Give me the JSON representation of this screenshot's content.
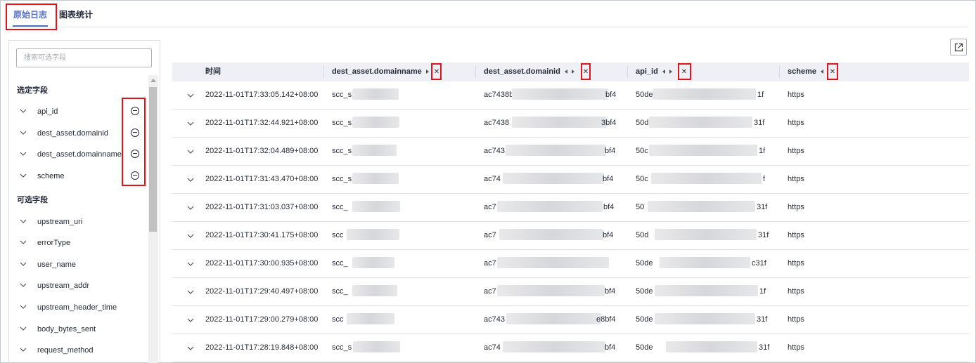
{
  "tabs": [
    {
      "label": "原始日志",
      "active": true
    },
    {
      "label": "图表统计",
      "active": false
    }
  ],
  "sidebar": {
    "search_placeholder": "搜索可选字段",
    "selected_title": "选定字段",
    "selected_fields": [
      "api_id",
      "dest_asset.domainid",
      "dest_asset.domainname",
      "scheme"
    ],
    "available_title": "可选字段",
    "available_fields": [
      "upstream_uri",
      "errorType",
      "user_name",
      "upstream_addr",
      "upstream_header_time",
      "body_bytes_sent",
      "request_method"
    ]
  },
  "table": {
    "headers": {
      "time": "时间",
      "domainname": "dest_asset.domainname",
      "domainid": "dest_asset.domainid",
      "api_id": "api_id",
      "scheme": "scheme"
    },
    "close_glyph": "✕",
    "rows": [
      {
        "time": "2022-11-01T17:33:05.142+08:00",
        "domainname": "scc_s",
        "domainid_pre": "ac7438b",
        "domainid_suf": "bf4",
        "api_pre": "50de",
        "api_suf": "1f",
        "scheme": "https"
      },
      {
        "time": "2022-11-01T17:32:44.921+08:00",
        "domainname": "scc_s",
        "domainid_pre": "ac7438",
        "domainid_suf": "3bf4",
        "api_pre": "50d",
        "api_suf": "31f",
        "scheme": "https"
      },
      {
        "time": "2022-11-01T17:32:04.489+08:00",
        "domainname": "scc_s",
        "domainid_pre": "ac743",
        "domainid_suf": "bf4",
        "api_pre": "50c",
        "api_suf": "1f",
        "scheme": "https"
      },
      {
        "time": "2022-11-01T17:31:43.470+08:00",
        "domainname": "scc_s",
        "domainid_pre": "ac74",
        "domainid_suf": "bf4",
        "api_pre": "50c",
        "api_suf": "f",
        "scheme": "https"
      },
      {
        "time": "2022-11-01T17:31:03.037+08:00",
        "domainname": "scc_",
        "domainid_pre": "ac7",
        "domainid_suf": "bf4",
        "api_pre": "50",
        "api_suf": "31f",
        "scheme": "https"
      },
      {
        "time": "2022-11-01T17:30:41.175+08:00",
        "domainname": "scc",
        "domainid_pre": "ac7",
        "domainid_suf": "bf4",
        "api_pre": "50d",
        "api_suf": "31f",
        "scheme": "https"
      },
      {
        "time": "2022-11-01T17:30:00.935+08:00",
        "domainname": "scc_",
        "domainid_pre": "ac7",
        "domainid_suf": "",
        "api_pre": "50de",
        "api_suf": "c31f",
        "scheme": "https"
      },
      {
        "time": "2022-11-01T17:29:40.497+08:00",
        "domainname": "scc_",
        "domainid_pre": "ac7",
        "domainid_suf": "bf4",
        "api_pre": "50de",
        "api_suf": "1f",
        "scheme": "https"
      },
      {
        "time": "2022-11-01T17:29:00.279+08:00",
        "domainname": "scc",
        "domainid_pre": "ac743",
        "domainid_suf": "e8bf4",
        "api_pre": "50de",
        "api_suf": "31f",
        "scheme": "https"
      },
      {
        "time": "2022-11-01T17:28:19.848+08:00",
        "domainname": "scc_s",
        "domainid_pre": "ac74",
        "domainid_suf": "bf4",
        "api_pre": "50de",
        "api_suf": "31f",
        "scheme": "https"
      }
    ]
  }
}
